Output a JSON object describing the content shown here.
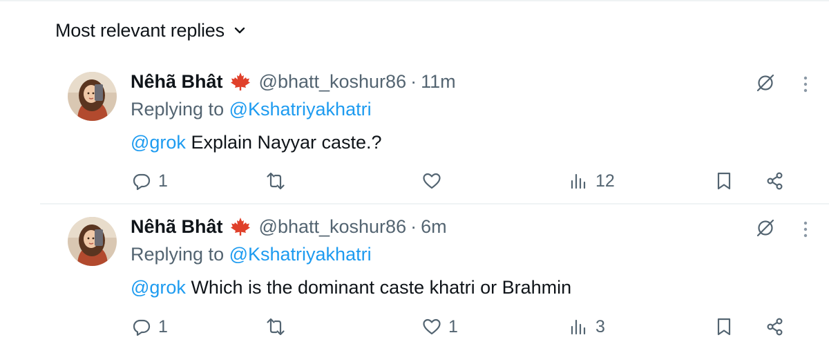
{
  "sort": {
    "label": "Most relevant replies",
    "icon": "chevron-down-icon"
  },
  "colors": {
    "accent": "#1d9bf0",
    "muted": "#536471",
    "text": "#0f1419",
    "divider": "#eff3f4"
  },
  "replies": [
    {
      "name": "Nêhã Bhât",
      "flag_icon": "maple-leaf-icon",
      "handle": "@bhatt_koshur86",
      "separator": "·",
      "time": "11m",
      "replying_prefix": "Replying to ",
      "replying_to": "@Kshatriyakhatri",
      "mention": "@grok",
      "text": " Explain Nayyar caste.?",
      "stats": {
        "replies": "1",
        "reposts": "",
        "likes": "",
        "views": "12"
      }
    },
    {
      "name": "Nêhã Bhât",
      "flag_icon": "maple-leaf-icon",
      "handle": "@bhatt_koshur86",
      "separator": "·",
      "time": "6m",
      "replying_prefix": "Replying to ",
      "replying_to": "@Kshatriyakhatri",
      "mention": "@grok",
      "text": " Which is the dominant caste khatri or Brahmin",
      "stats": {
        "replies": "1",
        "reposts": "",
        "likes": "1",
        "views": "3"
      }
    }
  ]
}
